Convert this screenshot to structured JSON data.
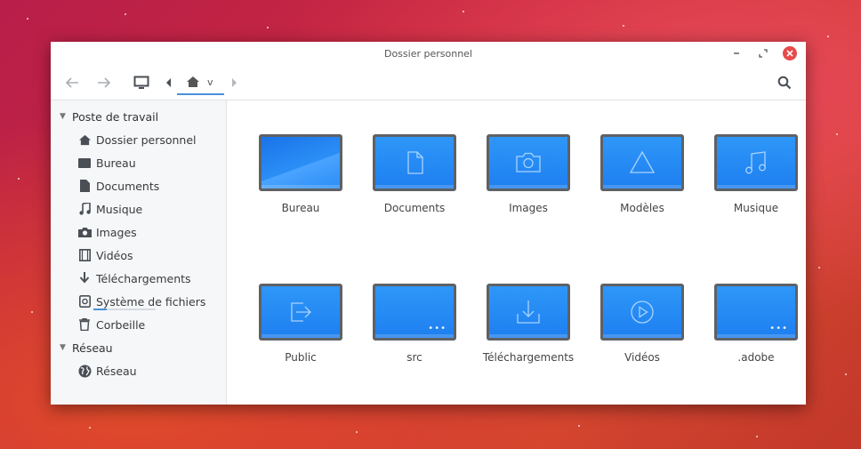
{
  "window": {
    "title": "Dossier personnel"
  },
  "toolbar": {
    "breadcrumb_label": "v"
  },
  "sidebar": {
    "sections": [
      {
        "label": "Poste de travail",
        "items": [
          {
            "label": "Dossier personnel",
            "icon": "home-icon"
          },
          {
            "label": "Bureau",
            "icon": "desktop-folder-icon"
          },
          {
            "label": "Documents",
            "icon": "document-icon"
          },
          {
            "label": "Musique",
            "icon": "music-icon"
          },
          {
            "label": "Images",
            "icon": "camera-icon"
          },
          {
            "label": "Vidéos",
            "icon": "film-icon"
          },
          {
            "label": "Téléchargements",
            "icon": "download-icon"
          },
          {
            "label": "Système de fichiers",
            "icon": "drive-icon",
            "usage_fraction": 0.22
          },
          {
            "label": "Corbeille",
            "icon": "trash-icon"
          }
        ]
      },
      {
        "label": "Réseau",
        "items": [
          {
            "label": "Réseau",
            "icon": "globe-icon"
          }
        ]
      }
    ]
  },
  "folders": [
    {
      "label": "Bureau",
      "icon": "desktop-folder-icon"
    },
    {
      "label": "Documents",
      "icon": "document-icon"
    },
    {
      "label": "Images",
      "icon": "camera-icon"
    },
    {
      "label": "Modèles",
      "icon": "triangle-icon"
    },
    {
      "label": "Musique",
      "icon": "music-icon"
    },
    {
      "label": "Public",
      "icon": "share-icon"
    },
    {
      "label": "src",
      "icon": "folder-dots-icon"
    },
    {
      "label": "Téléchargements",
      "icon": "download-icon"
    },
    {
      "label": "Vidéos",
      "icon": "play-icon"
    },
    {
      "label": ".adobe",
      "icon": "folder-dots-icon"
    }
  ],
  "colors": {
    "accent": "#4a90d9",
    "folder_blue": "#1e87f5",
    "close_red": "#e64a4a"
  }
}
